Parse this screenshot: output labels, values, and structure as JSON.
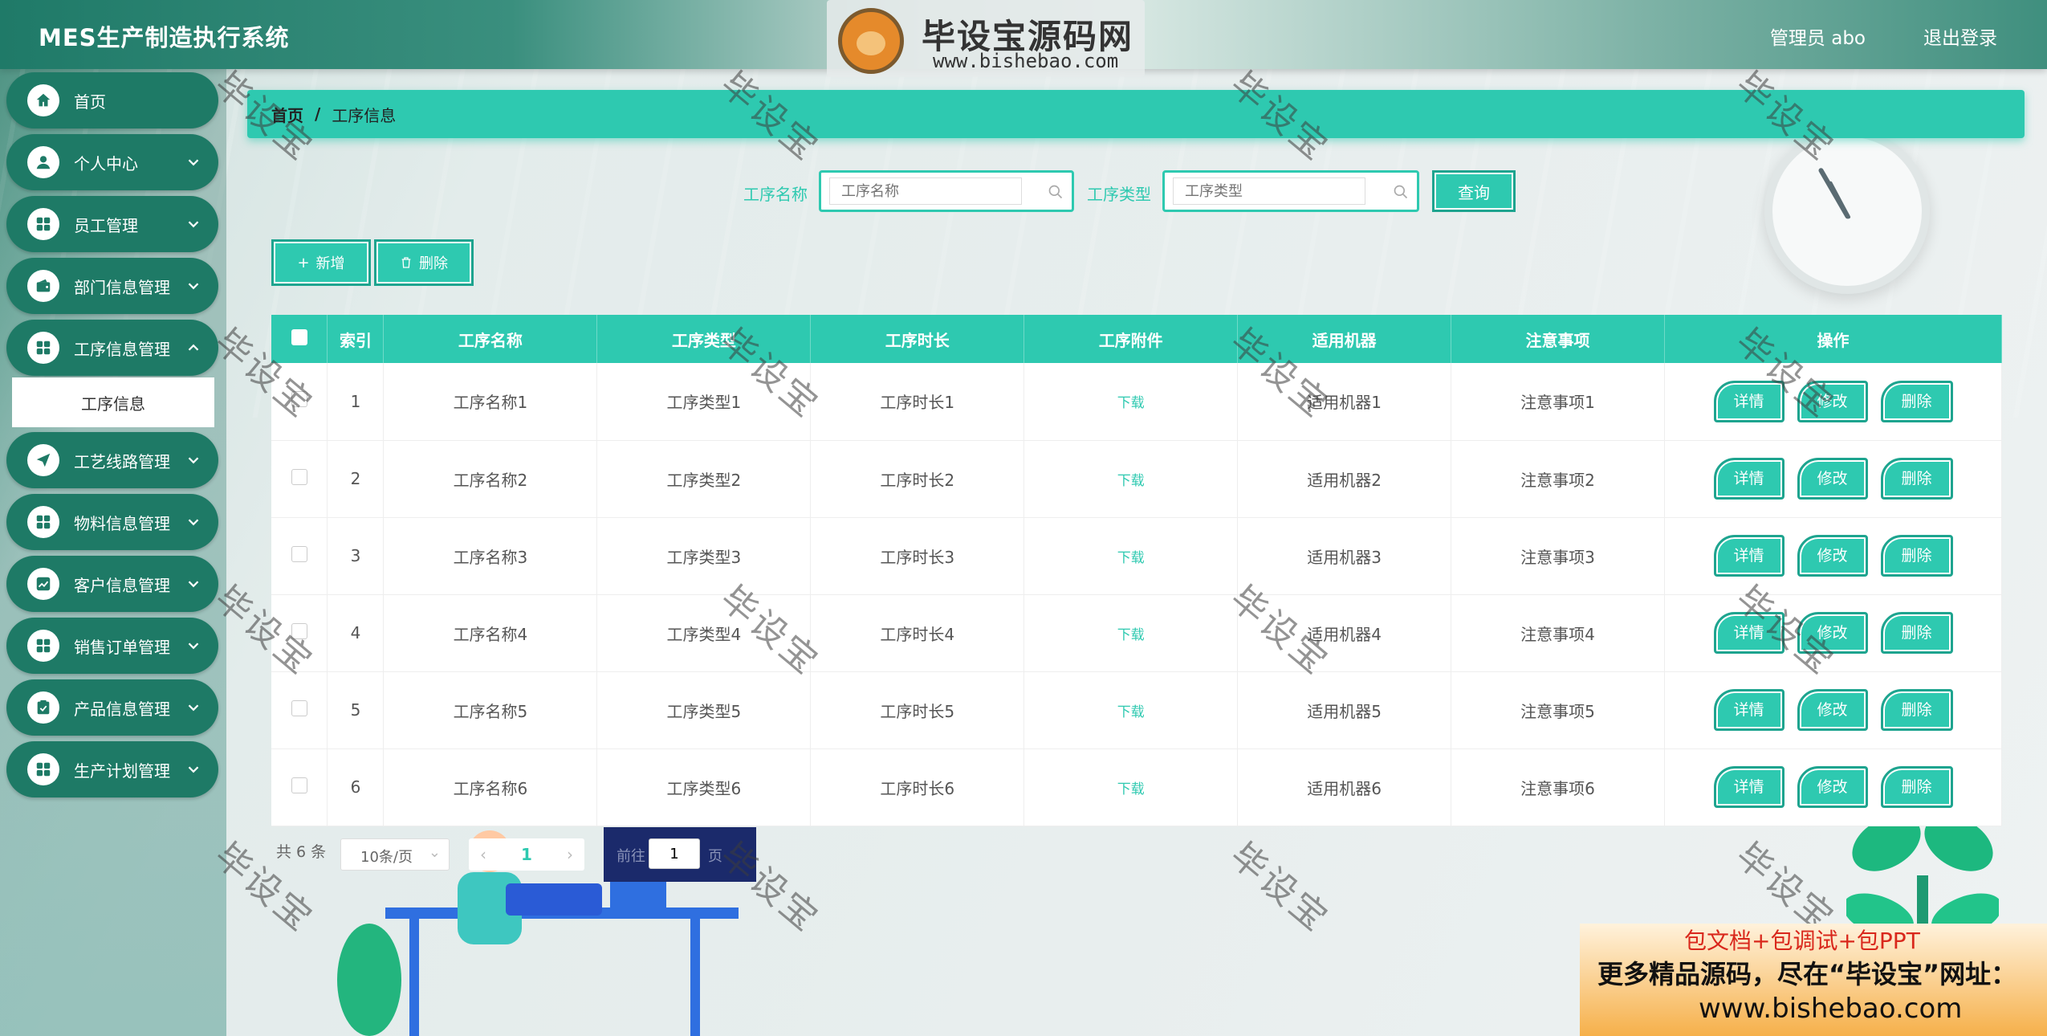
{
  "header": {
    "app_title": "MES生产制造执行系统",
    "user_label": "管理员 abo",
    "logout_label": "退出登录"
  },
  "watermark": {
    "logo_title": "毕设宝源码网",
    "logo_url": "www.bishebao.com",
    "logo_badge": "毕设宝",
    "repeat_text": "毕设宝"
  },
  "sidebar": {
    "items": [
      {
        "label": "首页",
        "icon": "home-icon"
      },
      {
        "label": "个人中心",
        "icon": "user-icon"
      },
      {
        "label": "员工管理",
        "icon": "grid-icon"
      },
      {
        "label": "部门信息管理",
        "icon": "wallet-icon"
      },
      {
        "label": "工序信息管理",
        "icon": "grid-icon"
      },
      {
        "label": "工艺线路管理",
        "icon": "send-icon"
      },
      {
        "label": "物料信息管理",
        "icon": "grid-icon"
      },
      {
        "label": "客户信息管理",
        "icon": "chart-icon"
      },
      {
        "label": "销售订单管理",
        "icon": "grid-icon"
      },
      {
        "label": "产品信息管理",
        "icon": "clipboard-icon"
      },
      {
        "label": "生产计划管理",
        "icon": "grid-icon"
      }
    ],
    "submenu_label": "工序信息"
  },
  "breadcrumb": {
    "home": "首页",
    "separator": "/",
    "current": "工序信息"
  },
  "search": {
    "name_label": "工序名称",
    "name_placeholder": "工序名称",
    "type_label": "工序类型",
    "type_placeholder": "工序类型",
    "query_label": "查询"
  },
  "actions": {
    "add_label": "新增",
    "delete_label": "删除"
  },
  "table": {
    "headers": [
      "索引",
      "工序名称",
      "工序类型",
      "工序时长",
      "工序附件",
      "适用机器",
      "注意事项",
      "操作"
    ],
    "rows": [
      [
        "1",
        "工序名称1",
        "工序类型1",
        "工序时长1",
        "下载",
        "适用机器1",
        "注意事项1"
      ],
      [
        "2",
        "工序名称2",
        "工序类型2",
        "工序时长2",
        "下载",
        "适用机器2",
        "注意事项2"
      ],
      [
        "3",
        "工序名称3",
        "工序类型3",
        "工序时长3",
        "下载",
        "适用机器3",
        "注意事项3"
      ],
      [
        "4",
        "工序名称4",
        "工序类型4",
        "工序时长4",
        "下载",
        "适用机器4",
        "注意事项4"
      ],
      [
        "5",
        "工序名称5",
        "工序类型5",
        "工序时长5",
        "下载",
        "适用机器5",
        "注意事项5"
      ],
      [
        "6",
        "工序名称6",
        "工序类型6",
        "工序时长6",
        "下载",
        "适用机器6",
        "注意事项6"
      ]
    ],
    "row_actions": {
      "detail": "详情",
      "edit": "修改",
      "delete": "删除"
    }
  },
  "pagination": {
    "total_text": "共 6 条",
    "page_size": "10条/页",
    "prev": "‹",
    "current_page": "1",
    "next": "›",
    "goto_prefix": "前往",
    "goto_value": "1",
    "goto_suffix": "页"
  },
  "promo": {
    "line1": "包文档+包调试+包PPT",
    "line2": "更多精品源码，尽在“毕设宝”网址：",
    "line3": "www.bishebao.com"
  },
  "colors": {
    "accent": "#2ec9b0",
    "sidebar_item": "#1e7a66"
  }
}
